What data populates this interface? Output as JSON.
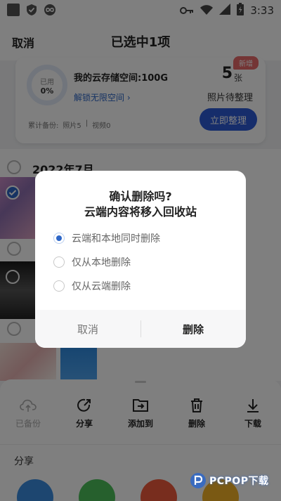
{
  "status_bar": {
    "time": "3:33",
    "left_icons": [
      "notification-square-icon",
      "shield-check-icon",
      "infinity-icon"
    ],
    "right_icons": [
      "key-icon",
      "wifi-icon",
      "signal-icon",
      "battery-charging-icon"
    ]
  },
  "header": {
    "cancel_label": "取消",
    "title": "已选中1项"
  },
  "storage_card": {
    "used_label": "已用",
    "used_percent": "0%",
    "storage_label": "我的云存储空间:100G",
    "unlock_link": "解锁无限空间",
    "backup_label": "累计备份:",
    "photos_label": "照片5",
    "videos_label": "视频0",
    "new_badge": "新增",
    "pending_count": "5",
    "pending_unit": "张",
    "pending_label": "照片待整理",
    "organize_button": "立即整理"
  },
  "photo_list": {
    "date_label": "2022年7月"
  },
  "toolbar": {
    "items": [
      {
        "label": "已备份",
        "icon": "cloud-upload-icon",
        "enabled": false
      },
      {
        "label": "分享",
        "icon": "share-icon",
        "enabled": true
      },
      {
        "label": "添加到",
        "icon": "add-to-folder-icon",
        "enabled": true
      },
      {
        "label": "删除",
        "icon": "trash-icon",
        "enabled": true
      },
      {
        "label": "下载",
        "icon": "download-icon",
        "enabled": true
      }
    ]
  },
  "share_section": {
    "title": "分享"
  },
  "watermark": {
    "text": "PCPOP下载"
  },
  "dialog": {
    "title_line1": "确认删除吗?",
    "title_line2": "云端内容将移入回收站",
    "options": [
      {
        "label": "云端和本地同时删除",
        "selected": true
      },
      {
        "label": "仅从本地删除",
        "selected": false
      },
      {
        "label": "仅从云端删除",
        "selected": false
      }
    ],
    "cancel_label": "取消",
    "delete_label": "删除"
  },
  "colors": {
    "accent": "#2d66c7",
    "primary_button": "#2d5bd7",
    "badge": "#e96b6b",
    "overlay": "rgba(0,0,0,0.5)"
  }
}
